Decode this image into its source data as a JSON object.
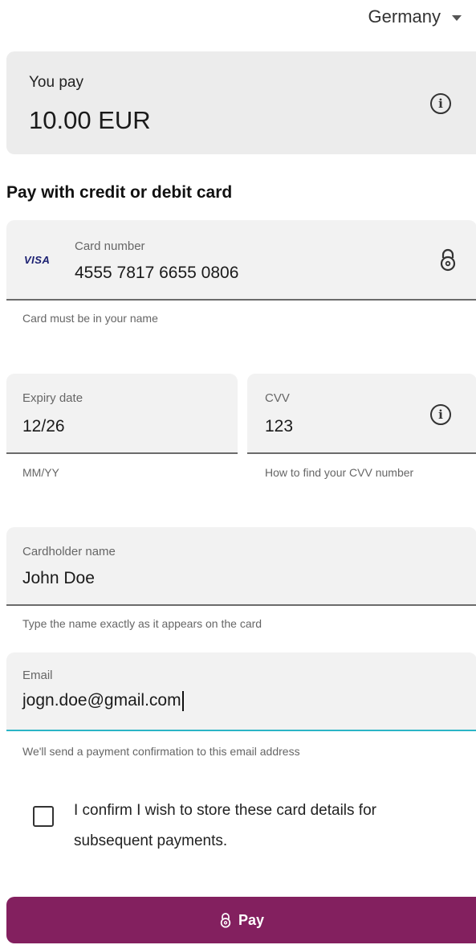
{
  "header": {
    "country": "Germany"
  },
  "summary": {
    "label": "You pay",
    "amount": "10.00 EUR"
  },
  "section_title": "Pay with credit or debit card",
  "card_number": {
    "brand": "VISA",
    "label": "Card number",
    "value": "4555 7817 6655 0806",
    "helper": "Card must be in your name"
  },
  "expiry": {
    "label": "Expiry date",
    "value": "12/26",
    "helper": "MM/YY"
  },
  "cvv": {
    "label": "CVV",
    "value": "123",
    "helper": "How to find your CVV number"
  },
  "cardholder": {
    "label": "Cardholder name",
    "value": "John Doe",
    "helper": "Type the name exactly as it appears on the card"
  },
  "email": {
    "label": "Email",
    "value": "jogn.doe@gmail.com",
    "helper": "We'll send a payment confirmation to this email address"
  },
  "store_card": {
    "label": "I confirm I wish to store these card details for subsequent payments.",
    "checked": false
  },
  "pay_button": {
    "label": "Pay"
  },
  "colors": {
    "accent": "#83205f",
    "focus": "#2bb5c6",
    "field_bg": "#f2f2f2"
  },
  "icons": [
    "chevron-down-icon",
    "info-icon",
    "lock-icon",
    "visa-logo"
  ]
}
